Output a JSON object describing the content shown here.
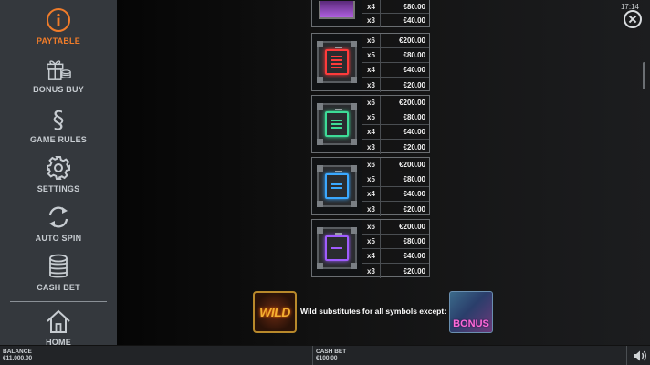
{
  "status": {
    "time": "17:14"
  },
  "sidebar": {
    "items": [
      {
        "label": "PAYTABLE",
        "icon": "info-icon",
        "active": true
      },
      {
        "label": "BONUS BUY",
        "icon": "gift-coins-icon"
      },
      {
        "label": "GAME RULES",
        "icon": "section-sign-icon"
      },
      {
        "label": "SETTINGS",
        "icon": "gear-icon"
      },
      {
        "label": "AUTO SPIN",
        "icon": "refresh-icon"
      },
      {
        "label": "CASH BET",
        "icon": "coin-stack-icon"
      },
      {
        "label": "HOME",
        "icon": "home-icon"
      }
    ]
  },
  "paytable": {
    "top_partial": [
      {
        "count": "x4",
        "value": "€80.00"
      },
      {
        "count": "x3",
        "value": "€40.00"
      }
    ],
    "rows": [
      {
        "symbol": "red-symbol-icon",
        "color": "#ff3b3b",
        "lines": [
          {
            "count": "x6",
            "value": "€200.00"
          },
          {
            "count": "x5",
            "value": "€80.00"
          },
          {
            "count": "x4",
            "value": "€40.00"
          },
          {
            "count": "x3",
            "value": "€20.00"
          }
        ]
      },
      {
        "symbol": "green-symbol-icon",
        "color": "#3ddc97",
        "lines": [
          {
            "count": "x6",
            "value": "€200.00"
          },
          {
            "count": "x5",
            "value": "€80.00"
          },
          {
            "count": "x4",
            "value": "€40.00"
          },
          {
            "count": "x3",
            "value": "€20.00"
          }
        ]
      },
      {
        "symbol": "blue-symbol-icon",
        "color": "#3aa8ff",
        "lines": [
          {
            "count": "x6",
            "value": "€200.00"
          },
          {
            "count": "x5",
            "value": "€80.00"
          },
          {
            "count": "x4",
            "value": "€40.00"
          },
          {
            "count": "x3",
            "value": "€20.00"
          }
        ]
      },
      {
        "symbol": "purple-symbol-icon",
        "color": "#a05cff",
        "lines": [
          {
            "count": "x6",
            "value": "€200.00"
          },
          {
            "count": "x5",
            "value": "€80.00"
          },
          {
            "count": "x4",
            "value": "€40.00"
          },
          {
            "count": "x3",
            "value": "€20.00"
          }
        ]
      }
    ]
  },
  "wild": {
    "label": "WILD",
    "description": "Wild substitutes for all symbols except:",
    "bonus_label": "BONUS"
  },
  "bottom": {
    "balance_label": "BALANCE",
    "balance_value": "€11,000.00",
    "cash_bet_label": "CASH BET",
    "cash_bet_value": "€100.00"
  }
}
